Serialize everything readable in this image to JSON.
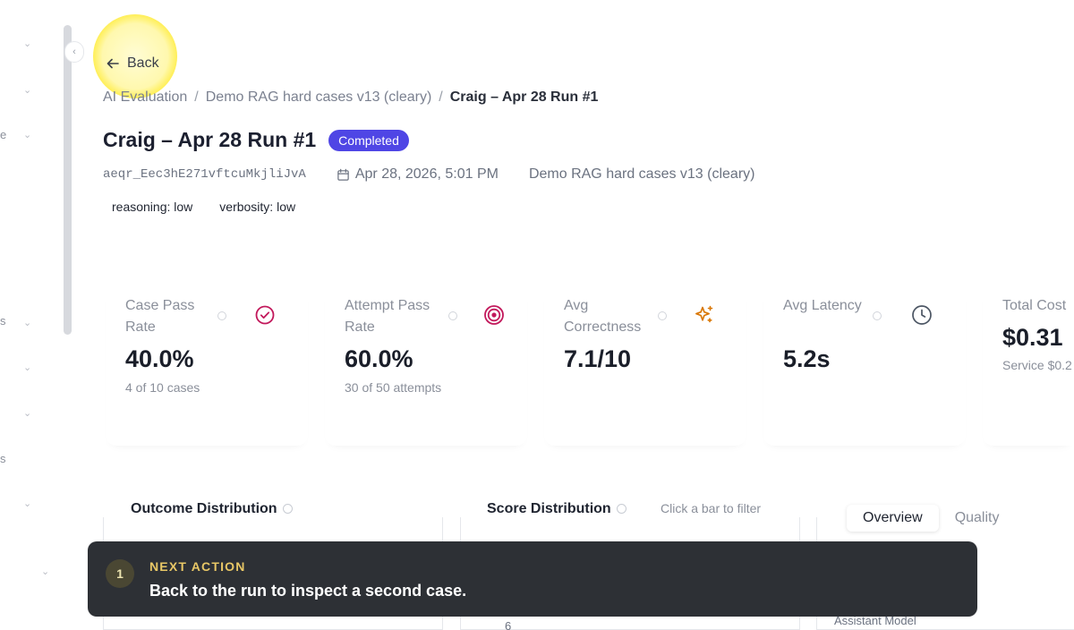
{
  "sidebar": {
    "label_fragments": [
      "e",
      "s",
      "s"
    ]
  },
  "nav": {
    "back_label": "Back"
  },
  "breadcrumb": {
    "items": [
      "AI Evaluation",
      "Demo RAG hard cases v13 (cleary)",
      "Craig – Apr 28 Run #1"
    ],
    "separator": "/"
  },
  "run": {
    "title": "Craig – Apr 28 Run #1",
    "status": "Completed",
    "id": "aeqr_Eec3hE271vftcuMkjliJvA",
    "date": "Apr 28, 2026, 5:01 PM",
    "dataset": "Demo RAG hard cases v13 (cleary)",
    "tags": [
      "reasoning: low",
      "verbosity: low"
    ]
  },
  "metrics": [
    {
      "label": "Case Pass Rate",
      "value": "40.0%",
      "sub": "4 of 10 cases",
      "icon": "check-circle-icon",
      "icon_color": "#c2185b"
    },
    {
      "label": "Attempt Pass Rate",
      "value": "60.0%",
      "sub": "30 of 50 attempts",
      "icon": "target-icon",
      "icon_color": "#c2185b"
    },
    {
      "label": "Avg Correctness",
      "value": "7.1/10",
      "sub": "",
      "icon": "sparkles-icon",
      "icon_color": "#d97706"
    },
    {
      "label": "Avg Latency",
      "value": "5.2s",
      "sub": "",
      "icon": "clock-icon",
      "icon_color": "#4b5563"
    },
    {
      "label": "Total Cost",
      "value": "$0.31",
      "sub": "Service $0.2",
      "icon": "",
      "icon_color": ""
    }
  ],
  "panels": {
    "outcome_title": "Outcome Distribution",
    "score_title": "Score Distribution",
    "score_hint": "Click a bar to filter",
    "tabs": [
      "Overview",
      "Quality"
    ],
    "active_tab": "Overview",
    "axis_fragment": "6",
    "assistant_model_label": "Assistant Model"
  },
  "toast": {
    "step": "1",
    "kicker": "NEXT ACTION",
    "text": "Back to the run to inspect a second case."
  },
  "colors": {
    "badge": "#4f46e5",
    "toast_bg": "#2d3035",
    "toast_kicker": "#e8c766",
    "highlight": "#ffec3c"
  }
}
